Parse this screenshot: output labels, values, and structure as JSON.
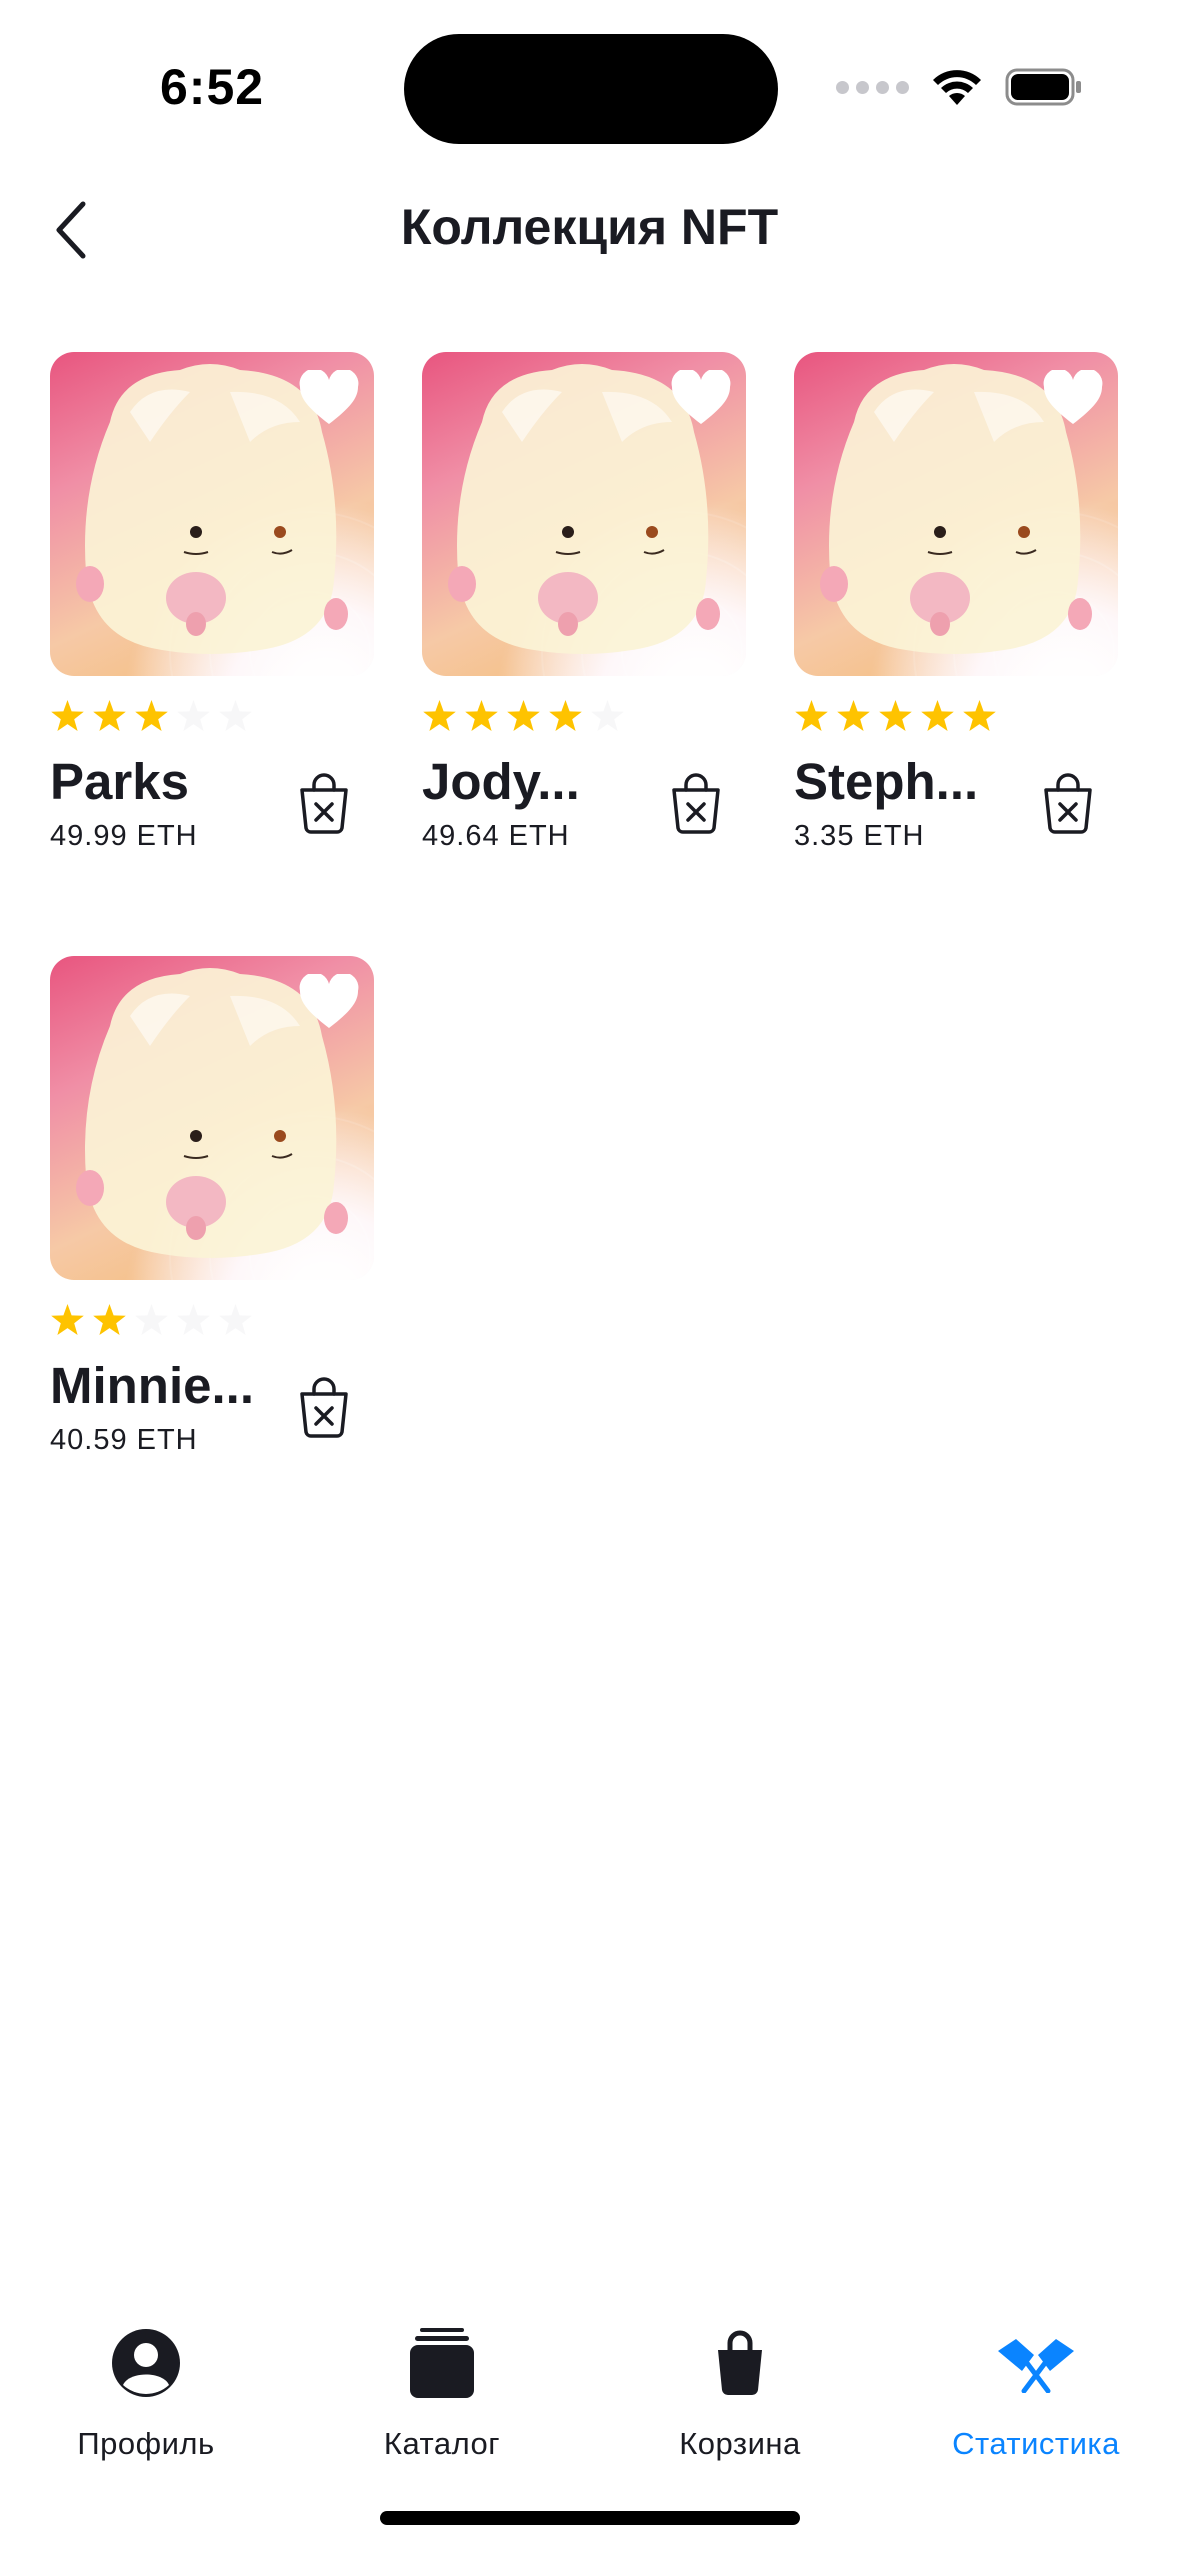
{
  "status_bar": {
    "time": "6:52"
  },
  "nav": {
    "title": "Коллекция NFT"
  },
  "nfts": [
    {
      "name": "Parks",
      "rating": 3,
      "price": "49.99 ETH"
    },
    {
      "name": "Jody...",
      "rating": 4,
      "price": "49.64 ETH"
    },
    {
      "name": "Steph...",
      "rating": 5,
      "price": "3.35 ETH"
    },
    {
      "name": "Minnie...",
      "rating": 2,
      "price": "40.59 ETH"
    }
  ],
  "tabbar": {
    "profile": "Профиль",
    "catalog": "Каталог",
    "cart": "Корзина",
    "stats": "Статистика"
  },
  "colors": {
    "accent": "#0a84ff",
    "star_active": "#fec300",
    "star_inactive": "#f7f7f8",
    "text": "#1a1b22"
  }
}
